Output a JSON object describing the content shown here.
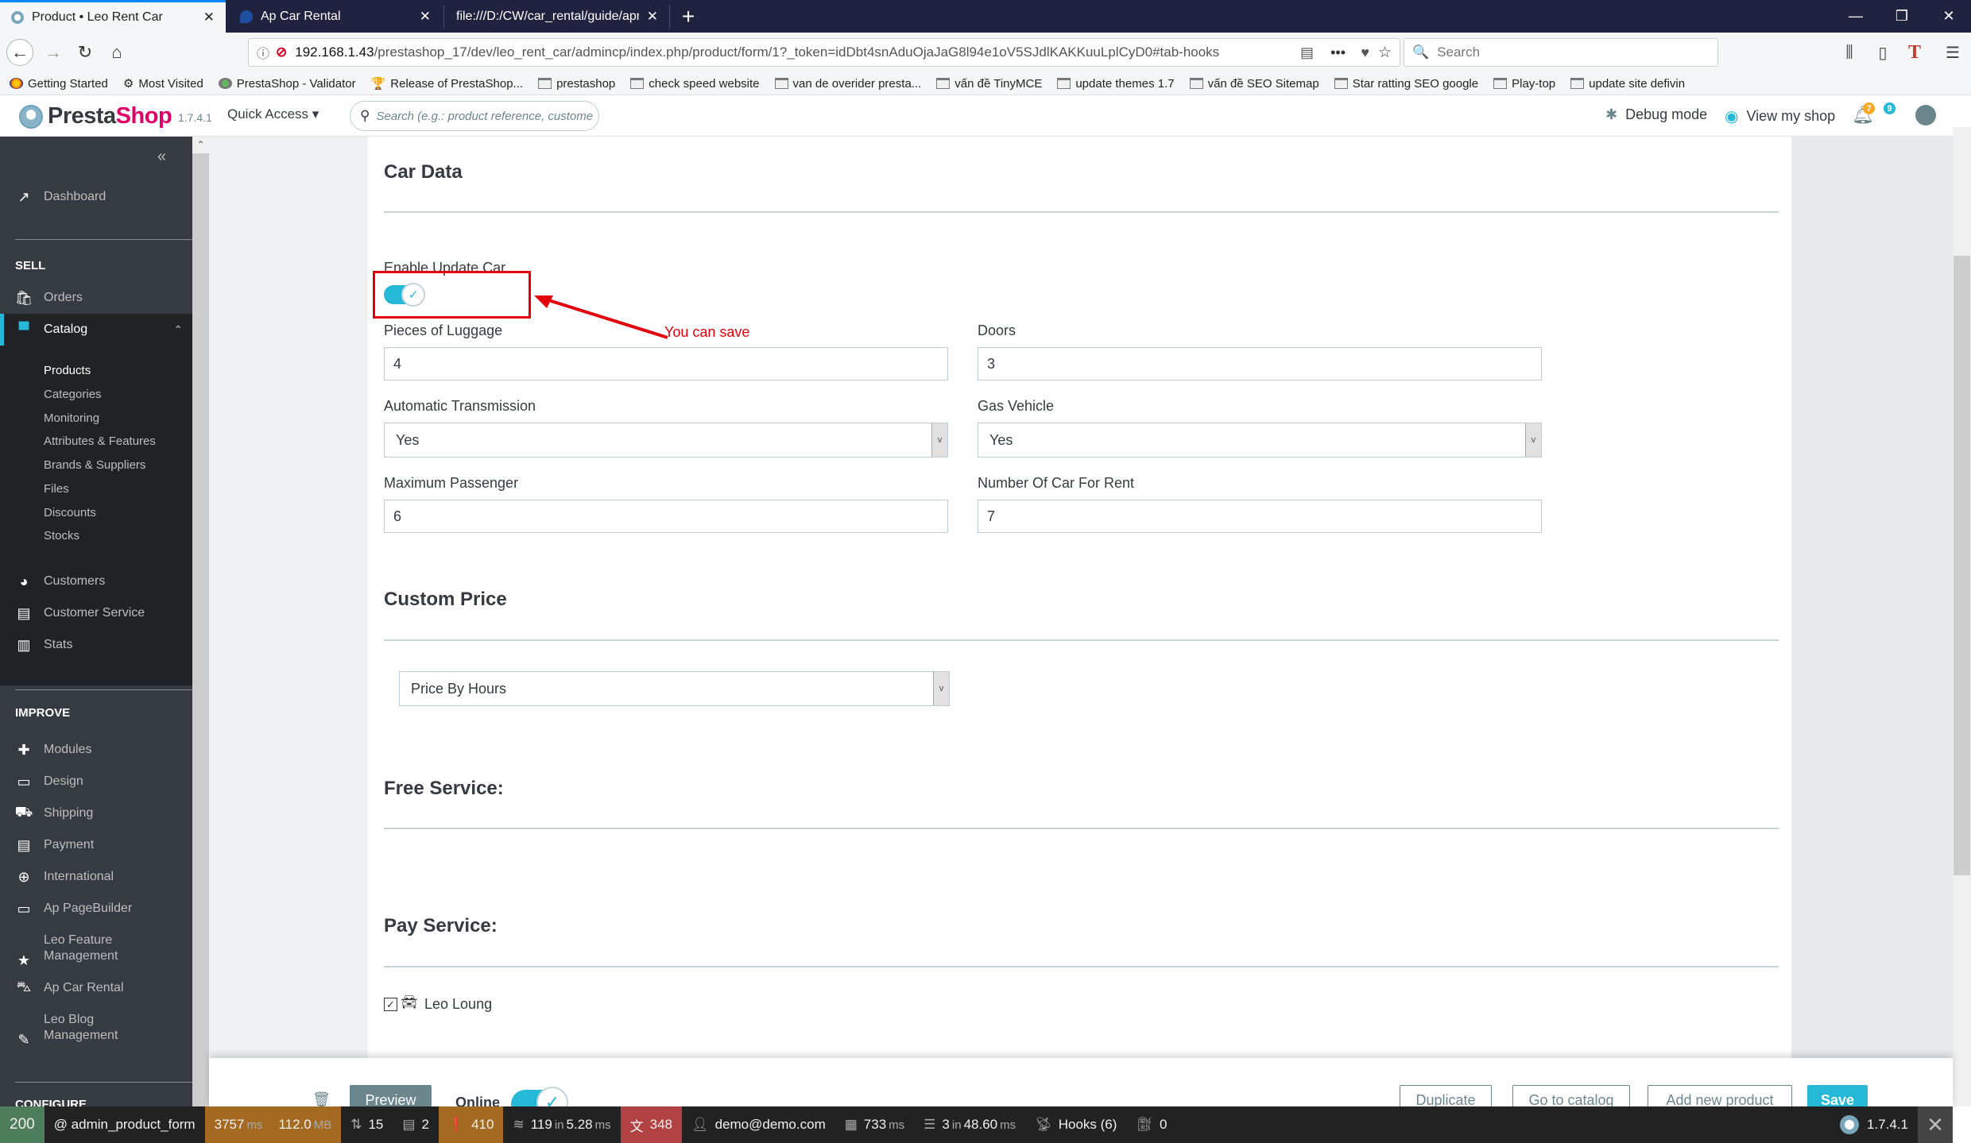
{
  "browser": {
    "tabs": [
      {
        "title": "Product • Leo Rent Car",
        "active": true
      },
      {
        "title": "Ap Car Rental",
        "active": false
      },
      {
        "title": "file:///D:/CW/car_rental/guide/apre",
        "active": false
      }
    ],
    "url": {
      "host": "192.168.1.43",
      "path": "/prestashop_17/dev/leo_rent_car/admincp/index.php/product/form/1?_token=idDbt4snAduOjaJaG8l94e1oV5SJdlKAKKuuLplCyD0#tab-hooks"
    },
    "search_placeholder": "Search",
    "bookmarks": [
      {
        "label": "Getting Started",
        "icon": "firefox-icon"
      },
      {
        "label": "Most Visited",
        "icon": "gear-icon"
      },
      {
        "label": "PrestaShop - Validator",
        "icon": "validator-icon"
      },
      {
        "label": "Release of PrestaShop...",
        "icon": "trophy-icon"
      },
      {
        "label": "prestashop",
        "icon": "folder-icon"
      },
      {
        "label": "check speed website",
        "icon": "folder-icon"
      },
      {
        "label": "van de overider presta...",
        "icon": "folder-icon"
      },
      {
        "label": "vấn đề TinyMCE",
        "icon": "folder-icon"
      },
      {
        "label": "update themes 1.7",
        "icon": "folder-icon"
      },
      {
        "label": "vấn đề SEO Sitemap",
        "icon": "folder-icon"
      },
      {
        "label": "Star ratting SEO google",
        "icon": "folder-icon"
      },
      {
        "label": "Play-top",
        "icon": "folder-icon"
      },
      {
        "label": "update site defivin",
        "icon": "folder-icon"
      }
    ]
  },
  "header": {
    "logo_presta": "Presta",
    "logo_shop": "Shop",
    "version": "1.7.4.1",
    "quick_access": "Quick Access ▾",
    "search_placeholder": "Search (e.g.: product reference, custome",
    "debug_mode": "Debug mode",
    "view_shop": "View my shop",
    "notifications_count": "7",
    "messages_count": "9"
  },
  "sidebar": {
    "collapse": "«",
    "dashboard": "Dashboard",
    "sell_title": "SELL",
    "orders": "Orders",
    "catalog": "Catalog",
    "catalog_sub": [
      "Products",
      "Categories",
      "Monitoring",
      "Attributes & Features",
      "Brands & Suppliers",
      "Files",
      "Discounts",
      "Stocks"
    ],
    "customers": "Customers",
    "customer_service": "Customer Service",
    "stats": "Stats",
    "improve_title": "IMPROVE",
    "improve_items": [
      {
        "label": "Modules",
        "icon": "puzzle-icon",
        "glyph": "✚"
      },
      {
        "label": "Design",
        "icon": "monitor-icon",
        "glyph": "▭"
      },
      {
        "label": "Shipping",
        "icon": "truck-icon",
        "glyph": "⛟"
      },
      {
        "label": "Payment",
        "icon": "credit-card-icon",
        "glyph": "▤"
      },
      {
        "label": "International",
        "icon": "globe-icon",
        "glyph": "🌐"
      },
      {
        "label": "Ap PageBuilder",
        "icon": "folder-icon",
        "glyph": "▭"
      },
      {
        "label": "Leo Feature\nManagement",
        "icon": "star-icon",
        "glyph": "★"
      },
      {
        "label": "Ap Car Rental",
        "icon": "car-icon",
        "glyph": "🚘"
      },
      {
        "label": "Leo Blog\nManagement",
        "icon": "pencil-icon",
        "glyph": "✎"
      }
    ],
    "configure_title": "CONFIGURE"
  },
  "form": {
    "car_data_title": "Car Data",
    "enable_update_label": "Enable Update Car",
    "enable_update_value": true,
    "luggage_label": "Pieces of Luggage",
    "luggage_value": "4",
    "doors_label": "Doors",
    "doors_value": "3",
    "auto_trans_label": "Automatic Transmission",
    "auto_trans_value": "Yes",
    "gas_label": "Gas Vehicle",
    "gas_value": "Yes",
    "max_pass_label": "Maximum Passenger",
    "max_pass_value": "6",
    "num_cars_label": "Number Of Car For Rent",
    "num_cars_value": "7",
    "custom_price_title": "Custom Price",
    "custom_price_value": "Price By Hours",
    "free_service_title": "Free Service:",
    "pay_service_title": "Pay Service:",
    "pay_services": [
      {
        "label": "Leo Loung",
        "checked": true
      }
    ]
  },
  "annotation": {
    "text": "You can save",
    "color": "#e3000b"
  },
  "actions": {
    "preview": "Preview",
    "online": "Online",
    "duplicate": "Duplicate",
    "go_to_catalog": "Go to catalog",
    "add_new_product": "Add new product",
    "save": "Save"
  },
  "debugbar": {
    "status": "200",
    "route": "@ admin_product_form",
    "time": "3757",
    "time_unit": "ms",
    "memory": "112.0",
    "memory_unit": "MB",
    "forms": "15",
    "logs": "2",
    "warnings": "410",
    "cache_count": "119",
    "cache_in": "in",
    "cache_time": "5.28",
    "cache_unit": "ms",
    "translations": "348",
    "user": "demo@demo.com",
    "twig_time": "733",
    "twig_unit": "ms",
    "db_count": "3",
    "db_in": "in",
    "db_time": "48.60",
    "db_unit": "ms",
    "hooks": "Hooks (6)",
    "modules": "0",
    "ps_version": "1.7.4.1"
  },
  "colors": {
    "accent": "#25b9d7",
    "sidebar_bg": "#363a41",
    "sidebar_active_bg": "#202226",
    "brand_pink": "#df0067"
  }
}
